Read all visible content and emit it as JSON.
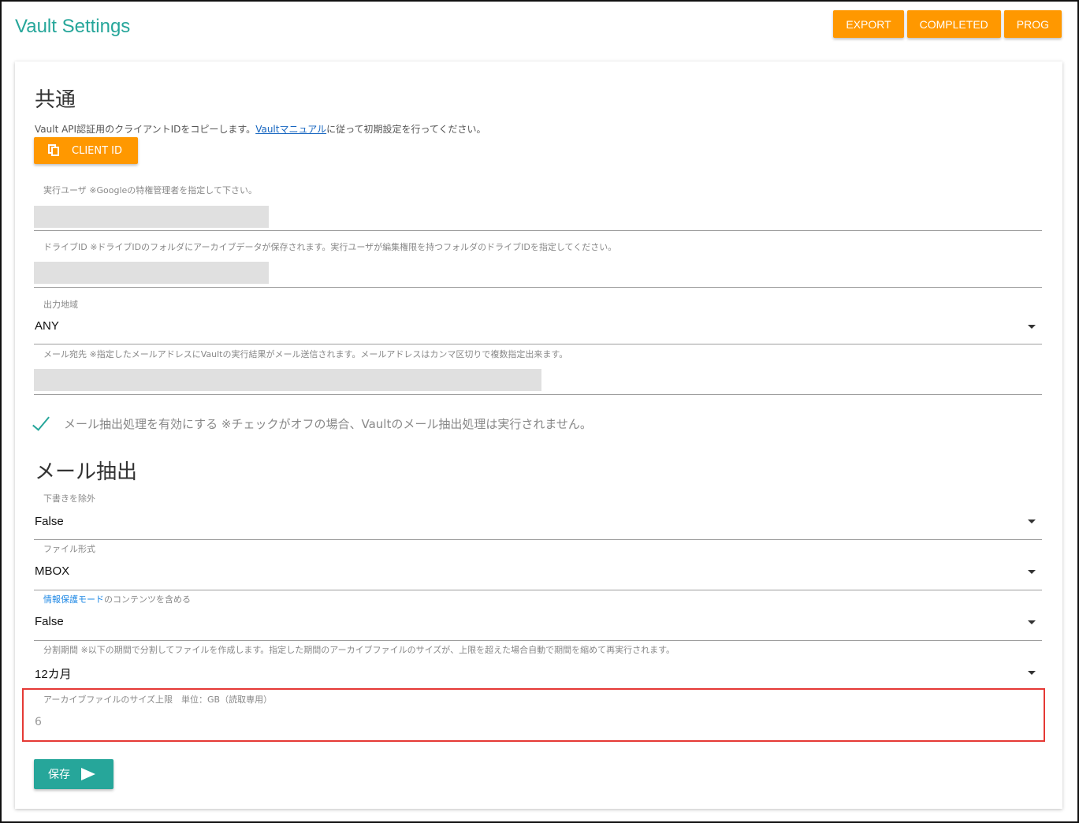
{
  "app": {
    "title": "Vault Settings"
  },
  "header_buttons": {
    "export": "EXPORT",
    "completed": "COMPLETED",
    "prog": "PROG"
  },
  "common": {
    "title": "共通",
    "instruction_prefix": "Vault API認証用のクライアントIDをコピーします。",
    "manual_link": "Vaultマニュアル",
    "instruction_suffix": "に従って初期設定を行ってください。",
    "client_id_button": "CLIENT ID",
    "exec_user_label": "実行ユーザ ※Googleの特権管理者を指定して下さい。",
    "drive_id_label": "ドライブID ※ドライブIDのフォルダにアーカイブデータが保存されます。実行ユーザが編集権限を持つフォルダのドライブIDを指定してください。",
    "region_label": "出力地域",
    "region_value": "ANY",
    "mail_to_label": "メール宛先 ※指定したメールアドレスにVaultの実行結果がメール送信されます。メールアドレスはカンマ区切りで複数指定出来ます。",
    "enable_mail_checkbox": "メール抽出処理を有効にする ※チェックがオフの場合、Vaultのメール抽出処理は実行されません。",
    "enable_mail_checked": true
  },
  "mail_extract": {
    "title": "メール抽出",
    "exclude_drafts_label": "下書きを除外",
    "exclude_drafts_value": "False",
    "file_format_label": "ファイル形式",
    "file_format_value": "MBOX",
    "confidential_mode_label_highlight": "情報保護モード",
    "confidential_mode_label_rest": "のコンテンツを含める",
    "confidential_mode_value": "False",
    "split_period_label": "分割期間 ※以下の期間で分割してファイルを作成します。指定した期間のアーカイブファイルのサイズが、上限を超えた場合自動で期間を縮めて再実行されます。",
    "split_period_value": "12カ月",
    "archive_size_label": "アーカイブファイルのサイズ上限　単位：GB（読取専用）",
    "archive_size_value": "6"
  },
  "save_button": "保存",
  "colors": {
    "accent": "#26a69a",
    "orange": "#ff9800",
    "highlight_border": "#e53935",
    "link": "#1565c0"
  }
}
